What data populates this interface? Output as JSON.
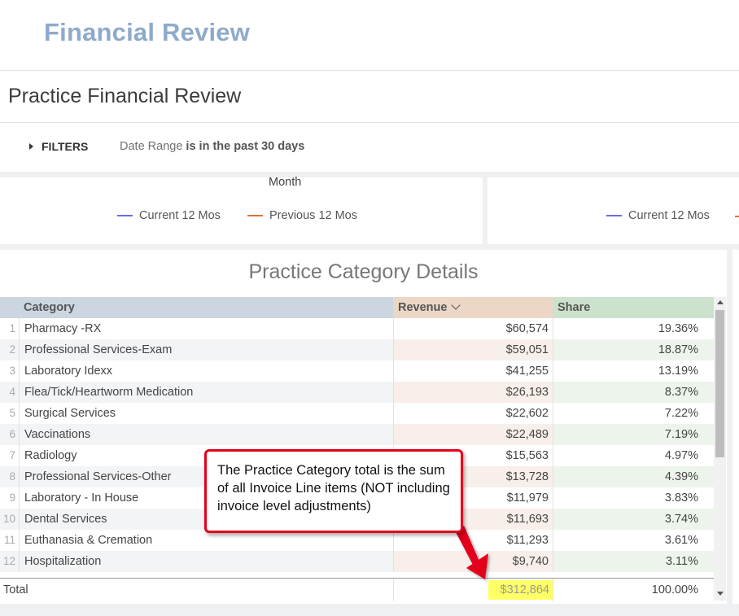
{
  "app": {
    "title": "Financial Review"
  },
  "dashboard": {
    "title": "Practice Financial Review"
  },
  "filters": {
    "toggle_label": "FILTERS",
    "field": "Date Range",
    "condition": "is in the past 30 days"
  },
  "chart_tiles": {
    "left": {
      "axis_title": "Month",
      "legend": [
        {
          "label": "Current 12 Mos",
          "color": "#6a6be6"
        },
        {
          "label": "Previous 12 Mos",
          "color": "#e0703a"
        }
      ]
    },
    "right": {
      "legend": [
        {
          "label": "Current 12 Mos",
          "color": "#6a6be6"
        }
      ]
    }
  },
  "table": {
    "title": "Practice Category Details",
    "columns": {
      "category": "Category",
      "revenue": "Revenue",
      "share": "Share"
    },
    "sort_icon": "chevron-down-icon",
    "rows": [
      {
        "index": "1",
        "category": "Pharmacy -RX",
        "revenue": "$60,574",
        "share": "19.36%"
      },
      {
        "index": "2",
        "category": "Professional Services-Exam",
        "revenue": "$59,051",
        "share": "18.87%"
      },
      {
        "index": "3",
        "category": "Laboratory Idexx",
        "revenue": "$41,255",
        "share": "13.19%"
      },
      {
        "index": "4",
        "category": "Flea/Tick/Heartworm Medication",
        "revenue": "$26,193",
        "share": "8.37%"
      },
      {
        "index": "5",
        "category": "Surgical Services",
        "revenue": "$22,602",
        "share": "7.22%"
      },
      {
        "index": "6",
        "category": "Vaccinations",
        "revenue": "$22,489",
        "share": "7.19%"
      },
      {
        "index": "7",
        "category": "Radiology",
        "revenue": "$15,563",
        "share": "4.97%"
      },
      {
        "index": "8",
        "category": "Professional Services-Other",
        "revenue": "$13,728",
        "share": "4.39%"
      },
      {
        "index": "9",
        "category": "Laboratory - In House",
        "revenue": "$11,979",
        "share": "3.83%"
      },
      {
        "index": "10",
        "category": "Dental Services",
        "revenue": "$11,693",
        "share": "3.74%"
      },
      {
        "index": "11",
        "category": "Euthanasia & Cremation",
        "revenue": "$11,293",
        "share": "3.61%"
      },
      {
        "index": "12",
        "category": "Hospitalization",
        "revenue": "$9,740",
        "share": "3.11%"
      }
    ],
    "total": {
      "label": "Total",
      "revenue": "$312,864",
      "share": "100.00%"
    }
  },
  "callout": {
    "text": "The Practice Category total is the sum of all Invoice Line items (NOT including invoice level adjustments)",
    "border_color": "#e3001b"
  },
  "colors": {
    "highlight": "#ffff66",
    "app_title": "#8eaacb"
  }
}
